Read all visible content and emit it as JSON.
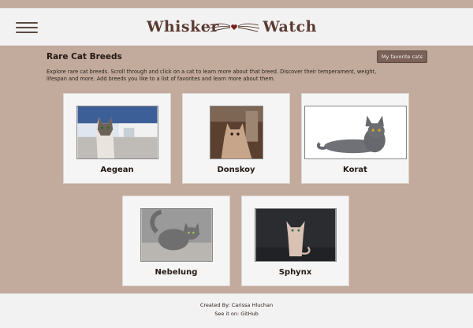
{
  "header": {
    "logo_left": "Whisker",
    "logo_right": "Watch",
    "menu_icon": "hamburger-menu-icon"
  },
  "main": {
    "title": "Rare Cat Breeds",
    "favorites_button": "My favorite cats",
    "intro": "Explore rare cat breeds. Scroll through and click on a cat to learn more about that breed. Discover their temperament, weight, lifespan and more. Add breeds you like to a list of favorites and learn more about them."
  },
  "breeds": [
    {
      "name": "Aegean"
    },
    {
      "name": "Donskoy"
    },
    {
      "name": "Korat"
    },
    {
      "name": "Nebelung"
    },
    {
      "name": "Sphynx"
    }
  ],
  "footer": {
    "created_by": "Created By: Carissa Hluchan",
    "see_it_prefix": "See it on: ",
    "github_link": "GitHub"
  },
  "colors": {
    "background": "#c2ab9c",
    "header_bg": "#f3f2f2",
    "logo": "#5a3a32",
    "button": "#7a6258"
  }
}
